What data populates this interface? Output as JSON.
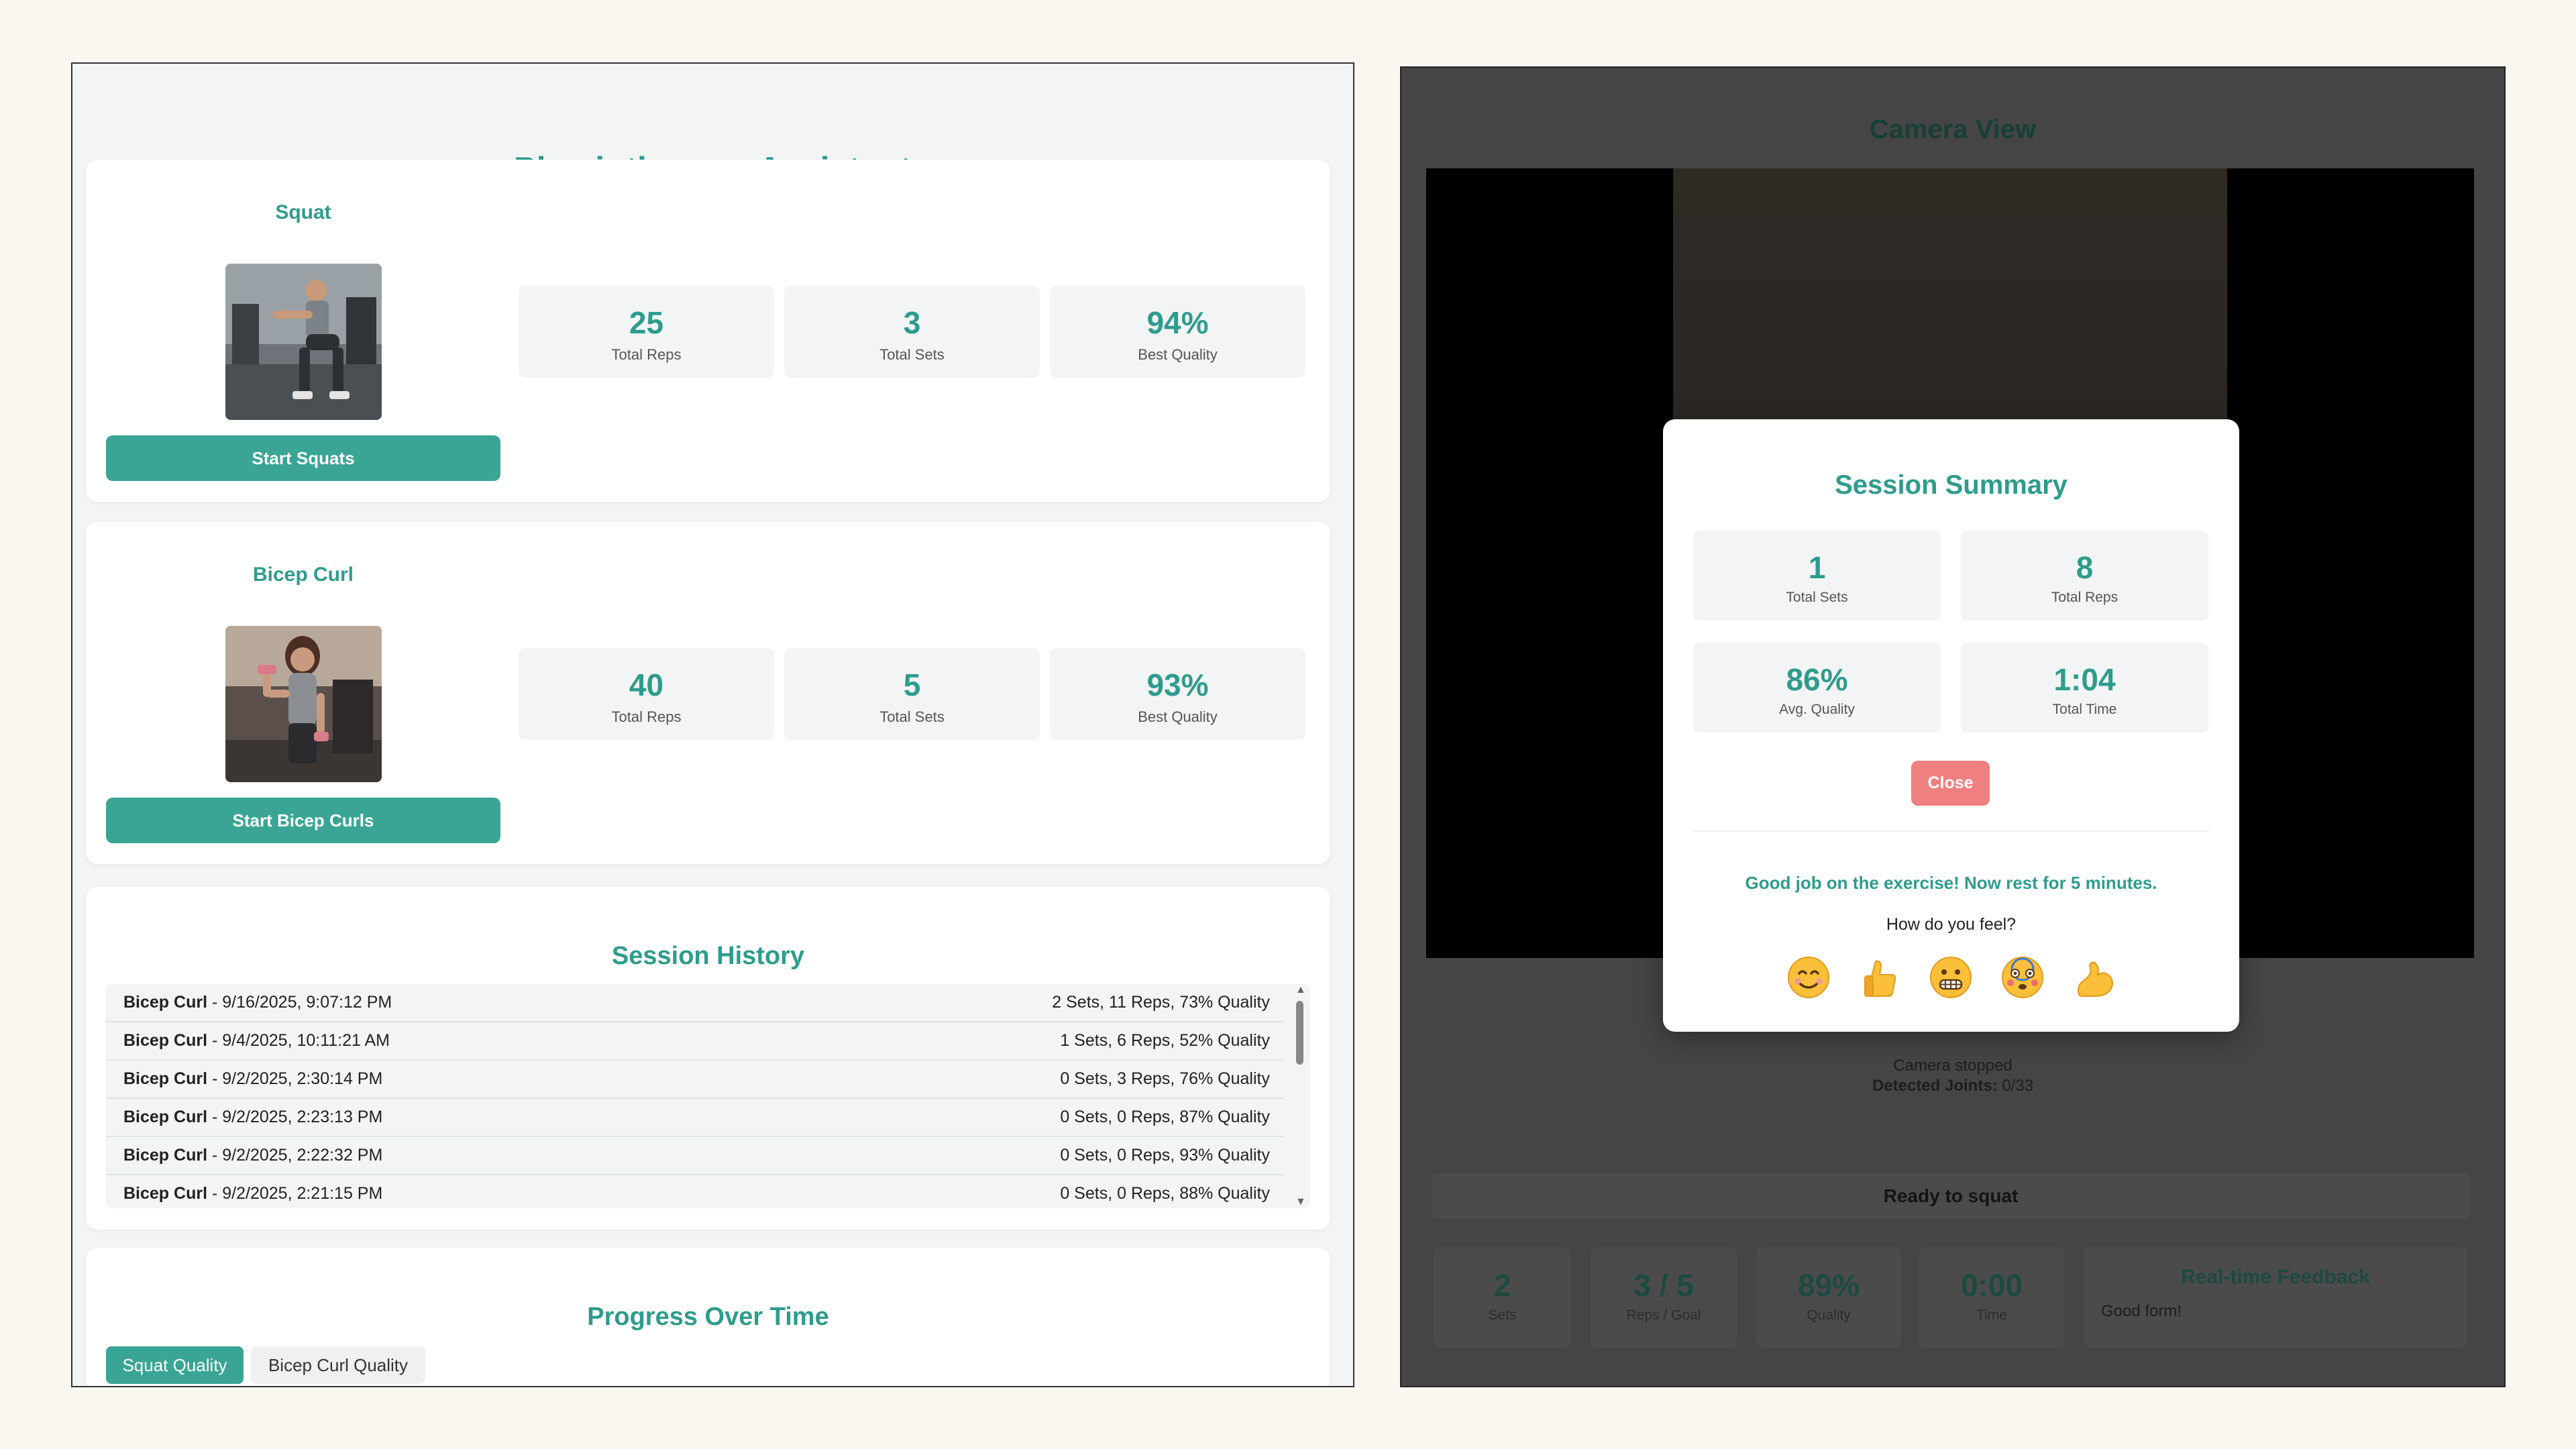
{
  "app": {
    "title": "Physiotherapy Assistant"
  },
  "exercises": [
    {
      "name": "Squat",
      "button": "Start Squats",
      "stats": [
        {
          "value": "25",
          "label": "Total Reps"
        },
        {
          "value": "3",
          "label": "Total Sets"
        },
        {
          "value": "94%",
          "label": "Best Quality"
        }
      ]
    },
    {
      "name": "Bicep Curl",
      "button": "Start Bicep Curls",
      "stats": [
        {
          "value": "40",
          "label": "Total Reps"
        },
        {
          "value": "5",
          "label": "Total Sets"
        },
        {
          "value": "93%",
          "label": "Best Quality"
        }
      ]
    }
  ],
  "history": {
    "title": "Session History",
    "rows": [
      {
        "exercise": "Bicep Curl",
        "date": " - 9/16/2025, 9:07:12 PM",
        "summary": "2 Sets, 11 Reps, 73% Quality"
      },
      {
        "exercise": "Bicep Curl",
        "date": " - 9/4/2025, 10:11:21 AM",
        "summary": "1 Sets, 6 Reps, 52% Quality"
      },
      {
        "exercise": "Bicep Curl",
        "date": " - 9/2/2025, 2:30:14 PM",
        "summary": "0 Sets, 3 Reps, 76% Quality"
      },
      {
        "exercise": "Bicep Curl",
        "date": " - 9/2/2025, 2:23:13 PM",
        "summary": "0 Sets, 0 Reps, 87% Quality"
      },
      {
        "exercise": "Bicep Curl",
        "date": " - 9/2/2025, 2:22:32 PM",
        "summary": "0 Sets, 0 Reps, 93% Quality"
      },
      {
        "exercise": "Bicep Curl",
        "date": " - 9/2/2025, 2:21:15 PM",
        "summary": "0 Sets, 0 Reps, 88% Quality"
      }
    ]
  },
  "progress": {
    "title": "Progress Over Time",
    "tabs": [
      "Squat Quality",
      "Bicep Curl Quality"
    ]
  },
  "camera": {
    "title": "Camera View",
    "status": "Camera stopped",
    "joints_label": "Detected Joints:",
    "joints_value": " 0/33",
    "ready": "Ready to squat"
  },
  "live_stats": [
    {
      "value": "2",
      "label": "Sets"
    },
    {
      "value": "3 / 5",
      "label": "Reps / Goal"
    },
    {
      "value": "89%",
      "label": "Quality"
    },
    {
      "value": "0:00",
      "label": "Time"
    }
  ],
  "feedback": {
    "title": "Real-time Feedback",
    "text": "Good form!"
  },
  "modal": {
    "title": "Session Summary",
    "stats": [
      {
        "value": "1",
        "label": "Total Sets"
      },
      {
        "value": "8",
        "label": "Total Reps"
      },
      {
        "value": "86%",
        "label": "Avg. Quality"
      },
      {
        "value": "1:04",
        "label": "Total Time"
      }
    ],
    "close": "Close",
    "message": "Good job on the exercise! Now rest for 5 minutes.",
    "question": "How do you feel?",
    "emojis": [
      "smiling-face-icon",
      "thumbs-up-icon",
      "grimacing-face-icon",
      "dizzy-face-icon",
      "flexed-biceps-icon"
    ]
  },
  "colors": {
    "accent": "#2e9c8c",
    "button": "#3aa594",
    "close": "#f07f7f",
    "overlay": "#454545"
  }
}
